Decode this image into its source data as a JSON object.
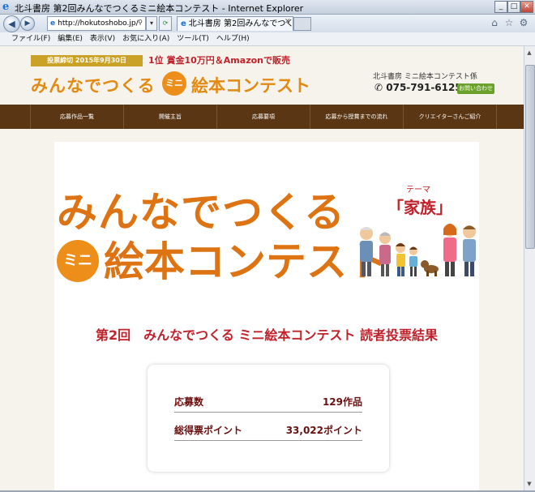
{
  "browser": {
    "title": "北斗書房 第2回みんなでつくるミニ絵本コンテスト - Internet Explorer",
    "address": "http://hokutoshobo.jp/",
    "tab_title": "北斗書房 第2回みんなでつく...",
    "menu": [
      "ファイル(F)",
      "編集(E)",
      "表示(V)",
      "お気に入り(A)",
      "ツール(T)",
      "ヘルプ(H)"
    ]
  },
  "header": {
    "deadline": "投票締切 2015年9月30日",
    "prize": "1位 賞金10万円＆Amazonで販売",
    "logo_left": "みんなでつくる",
    "logo_mini": "ミニ",
    "logo_right": "絵本コンテスト",
    "organizer": "北斗書房 ミニ絵本コンテスト係",
    "phone": "075-791-6125",
    "contact": "お問い合わせ"
  },
  "nav": [
    "応募作品一覧",
    "開催主旨",
    "応募要項",
    "応募から授賞までの流れ",
    "クリエイターさんご紹介"
  ],
  "hero": {
    "line1": "みんなでつくる",
    "mini": "ミニ",
    "line2": "絵本コンテスト",
    "theme_label": "テーマ",
    "theme": "「家族」"
  },
  "result_title": "第2回　みんなでつくる ミニ絵本コンテスト 読者投票結果",
  "stats": [
    {
      "label": "応募数",
      "value": "129作品"
    },
    {
      "label": "総得票ポイント",
      "value": "33,022ポイント"
    }
  ]
}
